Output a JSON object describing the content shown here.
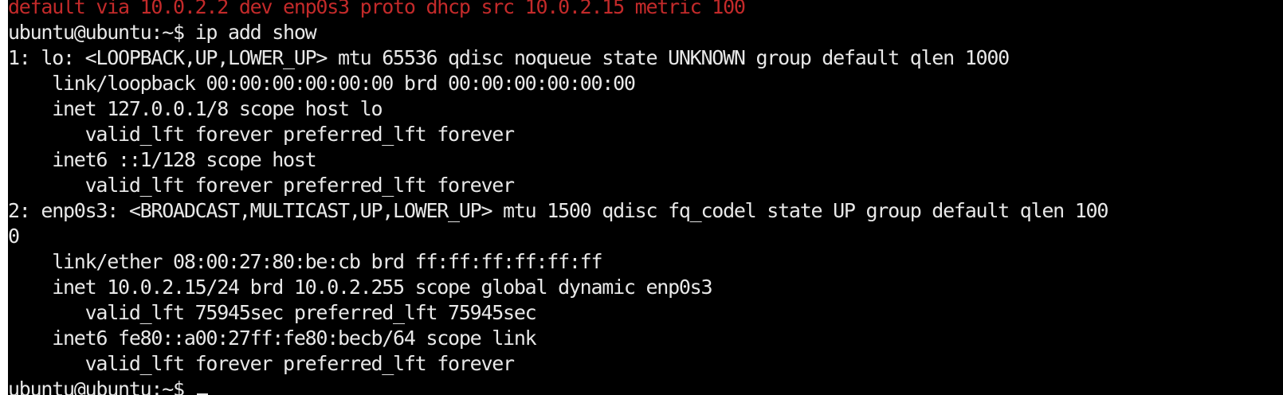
{
  "terminal": {
    "partial_top_line": "default via 10.0.2.2 dev enp0s3 proto dhcp src 10.0.2.15 metric 100",
    "lines": [
      "ubuntu@ubuntu:~$ ip add show",
      "1: lo: <LOOPBACK,UP,LOWER_UP> mtu 65536 qdisc noqueue state UNKNOWN group default qlen 1000",
      "    link/loopback 00:00:00:00:00:00 brd 00:00:00:00:00:00",
      "    inet 127.0.0.1/8 scope host lo",
      "       valid_lft forever preferred_lft forever",
      "    inet6 ::1/128 scope host",
      "       valid_lft forever preferred_lft forever",
      "2: enp0s3: <BROADCAST,MULTICAST,UP,LOWER_UP> mtu 1500 qdisc fq_codel state UP group default qlen 100",
      "0",
      "    link/ether 08:00:27:80:be:cb brd ff:ff:ff:ff:ff:ff",
      "    inet 10.0.2.15/24 brd 10.0.2.255 scope global dynamic enp0s3",
      "       valid_lft 75945sec preferred_lft 75945sec",
      "    inet6 fe80::a00:27ff:fe80:becb/64 scope link",
      "       valid_lft forever preferred_lft forever"
    ],
    "prompt": "ubuntu@ubuntu:~$ "
  },
  "colors": {
    "background": "#000000",
    "text": "#e8e8e8",
    "error_red": "#c32a2a"
  }
}
